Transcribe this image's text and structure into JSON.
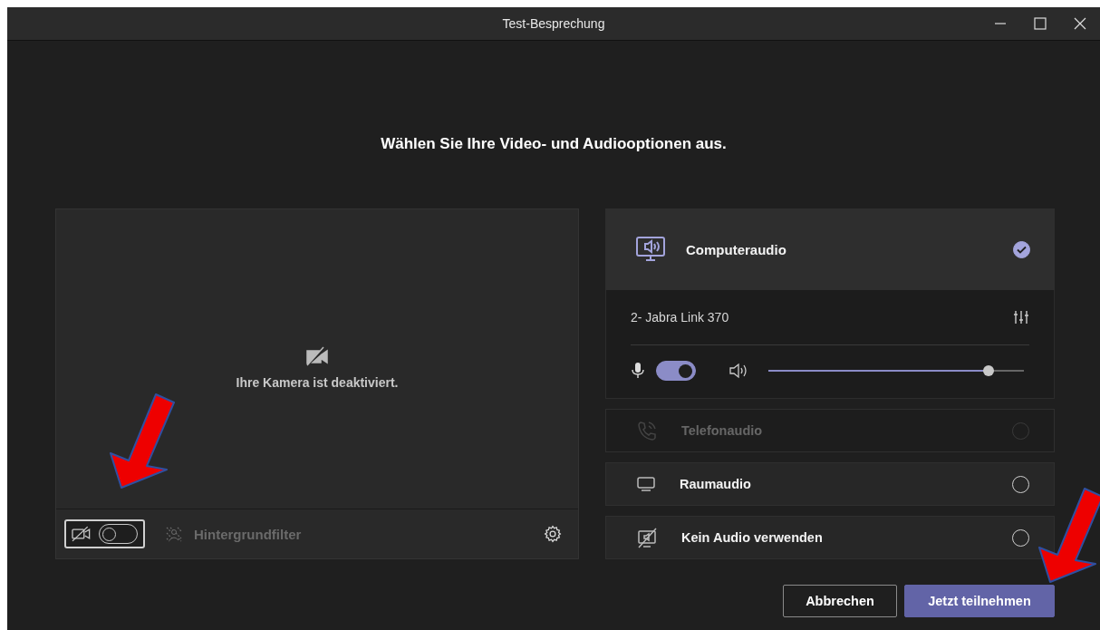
{
  "window": {
    "title": "Test-Besprechung"
  },
  "heading": "Wählen Sie Ihre Video- und Audiooptionen aus.",
  "video": {
    "message": "Ihre Kamera ist deaktiviert.",
    "camera_on": false,
    "background_filter": {
      "label": "Hintergrundfilter",
      "disabled": true
    }
  },
  "audio_options": [
    {
      "kind": "computer",
      "label": "Computeraudio",
      "selected": true,
      "disabled": false
    },
    {
      "kind": "phone",
      "label": "Telefonaudio",
      "selected": false,
      "disabled": true
    },
    {
      "kind": "room",
      "label": "Raumaudio",
      "selected": false,
      "disabled": false
    },
    {
      "kind": "none",
      "label": "Kein Audio verwenden",
      "selected": false,
      "disabled": false
    }
  ],
  "device": {
    "name": "2- Jabra Link 370",
    "mic_on": true,
    "volume": {
      "level": 0.86
    }
  },
  "buttons": [
    {
      "kind": "secondary",
      "label": "Abbrechen"
    },
    {
      "kind": "primary",
      "label": "Jetzt teilnehmen"
    }
  ],
  "annotations": [
    {
      "kind": "arrow"
    },
    {
      "kind": "arrow"
    }
  ]
}
